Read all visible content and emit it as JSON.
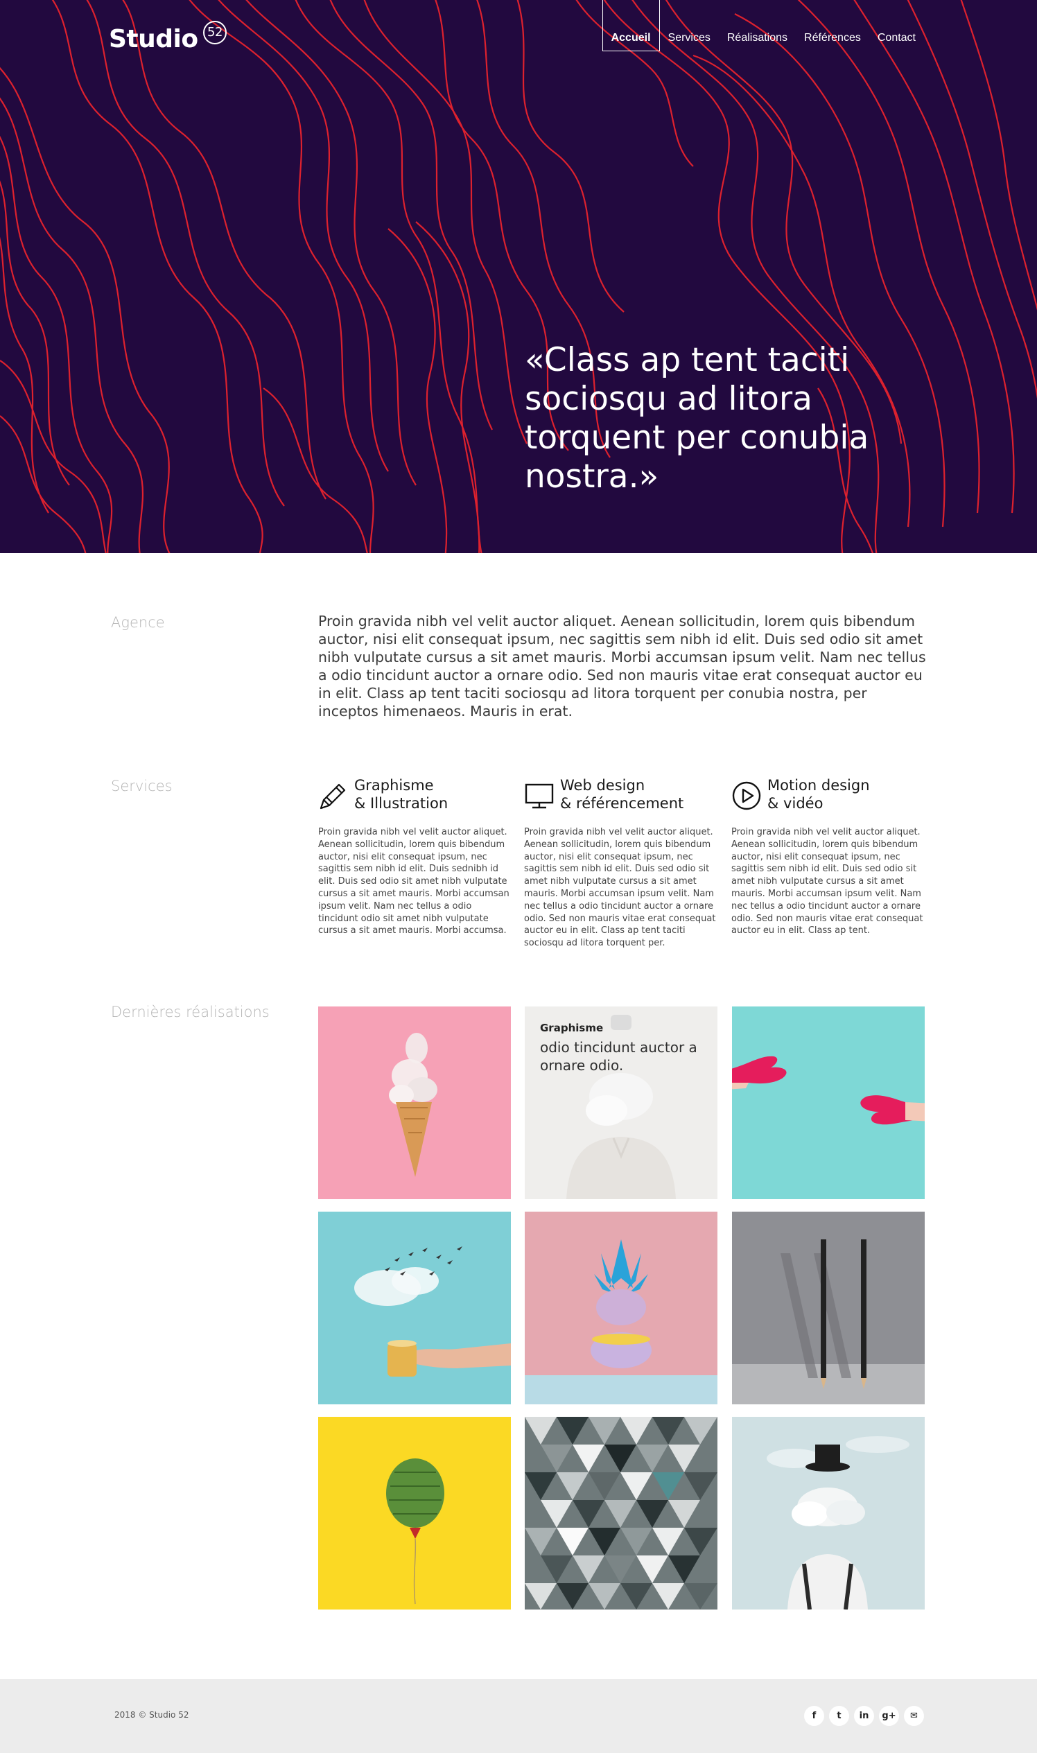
{
  "header": {
    "logo_word": "Studio",
    "logo_badge": "52",
    "nav": [
      {
        "label": "Accueil",
        "active": true
      },
      {
        "label": "Services"
      },
      {
        "label": "Réalisations"
      },
      {
        "label": "Références"
      },
      {
        "label": "Contact"
      }
    ]
  },
  "hero": {
    "quote": "«Class ap tent taciti sociosqu ad litora torquent per conubia nostra.»",
    "colors": {
      "background": "#22093f",
      "lines": "#e8232e"
    }
  },
  "agence": {
    "label": "Agence",
    "text": "Proin gravida nibh vel velit auctor aliquet. Aenean sollicitudin, lorem quis bibendum auctor, nisi elit consequat ipsum, nec sagittis sem nibh id elit. Duis sed odio sit amet nibh vulputate cursus a sit amet mauris. Morbi accumsan ipsum velit. Nam nec tellus a odio tincidunt auctor a ornare odio. Sed non  mauris vitae erat consequat auctor eu in elit. Class ap tent taciti sociosqu ad litora torquent per conubia nostra, per inceptos himenaeos. Mauris in erat."
  },
  "services": {
    "label": "Services",
    "items": [
      {
        "title_line1": "Graphisme",
        "title_line2": "& Illustration",
        "icon": "pencil-icon",
        "text": "Proin gravida nibh vel velit auctor aliquet. Aenean sollicitudin, lorem quis bibendum auctor, nisi elit consequat ipsum, nec sagittis sem nibh id elit. Duis sednibh id elit. Duis sed odio sit amet nibh vulputate cursus a sit amet mauris. Morbi accumsan ipsum velit. Nam nec tellus a odio tincidunt odio sit amet nibh vulputate cursus a sit amet mauris. Morbi accumsa."
      },
      {
        "title_line1": "Web design",
        "title_line2": "& référencement",
        "icon": "monitor-icon",
        "text": "Proin gravida nibh vel velit auctor aliquet. Aenean sollicitudin, lorem quis bibendum auctor, nisi elit consequat ipsum, nec sagittis sem nibh id elit. Duis sed odio sit amet nibh vulputate cursus a sit amet mauris. Morbi accumsan ipsum velit. Nam nec tellus a odio tincidunt auctor a ornare odio. Sed non  mauris vitae erat consequat auctor eu in elit. Class ap tent taciti sociosqu ad litora torquent per."
      },
      {
        "title_line1": "Motion design",
        "title_line2": "& vidéo",
        "icon": "play-circle-icon",
        "text": "Proin gravida nibh vel velit auctor aliquet. Aenean sollicitudin, lorem quis bibendum auctor, nisi elit consequat ipsum, nec sagittis sem nibh id elit. Duis sed odio sit amet nibh vulputate cursus a sit amet mauris. Morbi accumsan ipsum velit. Nam nec tellus a odio tincidunt auctor a ornare odio. Sed non  mauris vitae erat consequat auctor eu in elit. Class ap tent."
      }
    ]
  },
  "realisations": {
    "label": "Dernières réalisations",
    "hover_caption": {
      "category": "Graphisme",
      "description": "odio tincidunt auctor a ornare odio."
    }
  },
  "footer": {
    "copyright": "2018 © Studio 52",
    "socials": [
      {
        "icon": "facebook-icon",
        "glyph": "f"
      },
      {
        "icon": "twitter-icon",
        "glyph": "t"
      },
      {
        "icon": "linkedin-icon",
        "glyph": "in"
      },
      {
        "icon": "google-plus-icon",
        "glyph": "g+"
      },
      {
        "icon": "mail-icon",
        "glyph": "✉"
      }
    ]
  }
}
